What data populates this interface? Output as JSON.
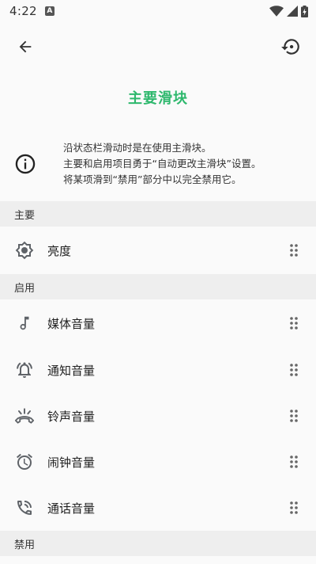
{
  "status_bar": {
    "time": "4:22",
    "notification_glyph": "A"
  },
  "toolbar": {
    "back_icon": "arrow-back-icon",
    "reset_icon": "restore-icon"
  },
  "page": {
    "title": "主要滑块",
    "info_lines": [
      "沿状态栏滑动时是在使用主滑块。",
      "主要和启用项目勇于“自动更改主滑块”设置。",
      "将某项滑到“禁用”部分中以完全禁用它。"
    ]
  },
  "sections": {
    "primary": {
      "header": "主要",
      "items": [
        {
          "label": "亮度",
          "icon": "brightness-icon"
        }
      ]
    },
    "enabled": {
      "header": "启用",
      "items": [
        {
          "label": "媒体音量",
          "icon": "music-note-icon"
        },
        {
          "label": "通知音量",
          "icon": "notification-bell-icon"
        },
        {
          "label": "铃声音量",
          "icon": "ringer-phone-icon"
        },
        {
          "label": "闹钟音量",
          "icon": "alarm-clock-icon"
        },
        {
          "label": "通话音量",
          "icon": "phone-call-icon"
        }
      ]
    },
    "disabled": {
      "header": "禁用"
    }
  },
  "colors": {
    "accent": "#2eb86d",
    "section_bg": "#eeeeee",
    "icon": "#5f6368"
  }
}
